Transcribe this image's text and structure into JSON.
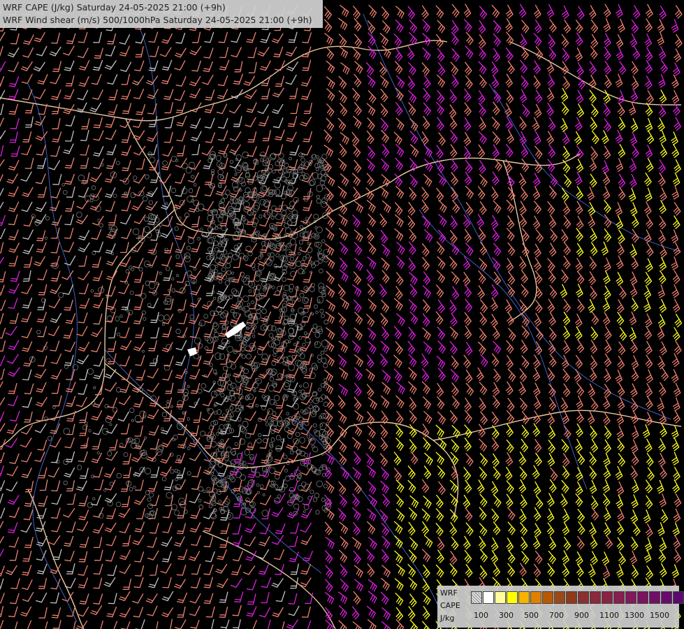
{
  "title": {
    "line1": "WRF CAPE (J/kg) Saturday 24-05-2025 21:00 (+9h)",
    "line2": "WRF Wind shear (m/s) 500/1000hPa Saturday 24-05-2025 21:00 (+9h)"
  },
  "legend": {
    "model": "WRF",
    "field": "CAPE",
    "unit": "J/kg",
    "ticks": [
      "100",
      "300",
      "500",
      "700",
      "900",
      "1100",
      "1300",
      "1500"
    ],
    "colors": [
      "#ffffff",
      "#fffc9a",
      "#ffff00",
      "#f4b400",
      "#e08000",
      "#b85800",
      "#9a4a18",
      "#8f3a1a",
      "#8a3030",
      "#8b2a3a",
      "#8a2244",
      "#86204e",
      "#801a58",
      "#7a1460",
      "#700e68",
      "#660a6c",
      "#5a0a6e"
    ]
  },
  "colors": {
    "background": "#000000",
    "barb_low": "#ffffff",
    "barb_moderate": "#f08070",
    "barb_strong": "#e020e0",
    "barb_cape": "#ffff20",
    "borders": "#e8c8a0",
    "rivers": "#4060c0",
    "terrain": "#a0a0a0"
  }
}
